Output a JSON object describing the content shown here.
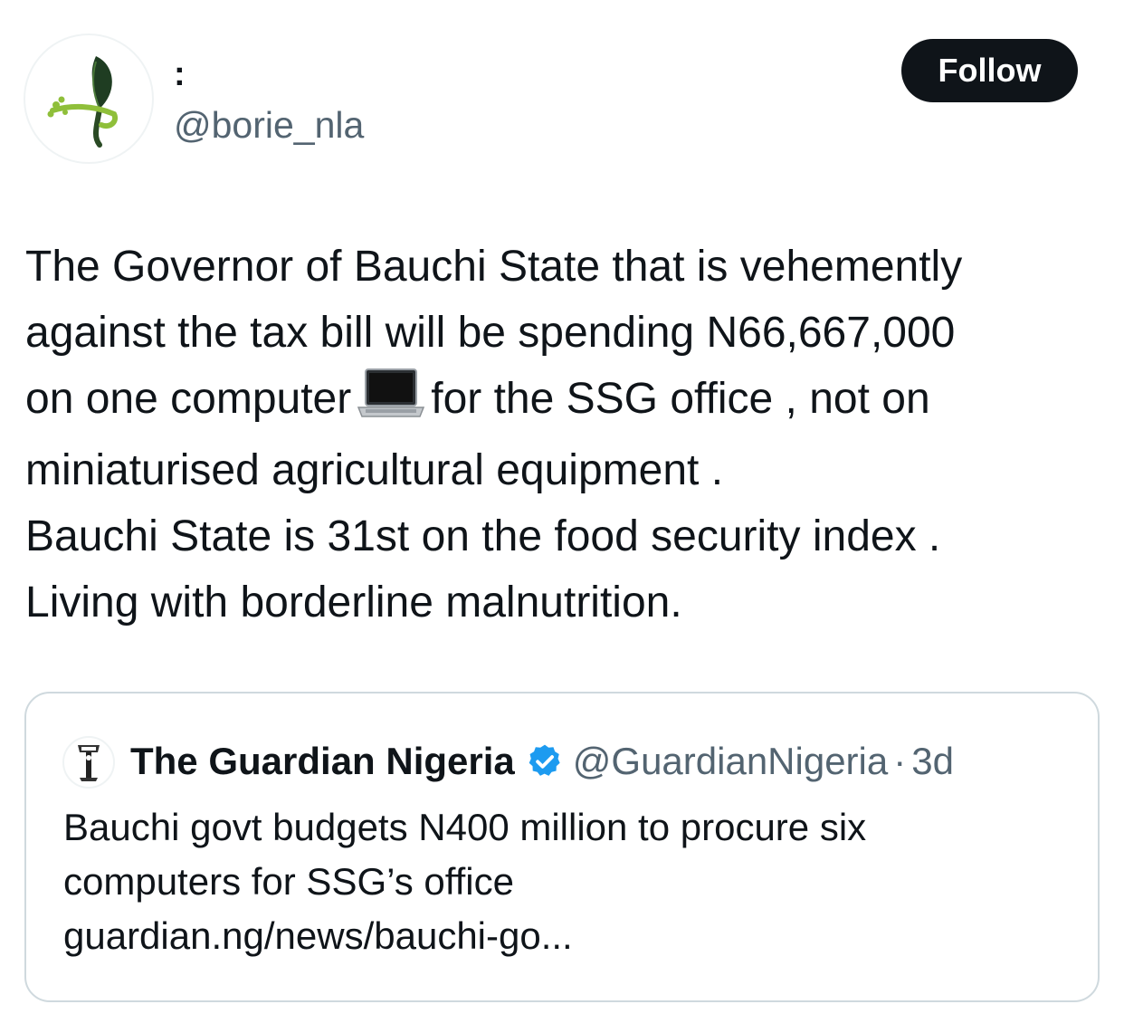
{
  "author": {
    "display_name": ":",
    "handle": "@borie_nla",
    "avatar_icon": "green-leaf-logo-icon"
  },
  "follow_label": "Follow",
  "tweet": {
    "line1": "The Governor of Bauchi State that is vehemently",
    "line2": "against the tax bill will be spending N66,667,000",
    "line3_before": "on one computer",
    "line3_emoji": "laptop-icon",
    "line3_after": "for the SSG office , not on",
    "line4": "miniaturised agricultural equipment .",
    "line5": "Bauchi State is 31st on the food security index .",
    "line6": "Living with borderline malnutrition."
  },
  "quote": {
    "avatar_icon": "guardian-crest-icon",
    "name": "The Guardian Nigeria",
    "verified_icon": "verified-badge-icon",
    "handle": "@GuardianNigeria",
    "separator": "·",
    "time": "3d",
    "line1": "Bauchi govt budgets N400 million to procure six",
    "line2": "computers for SSG’s office",
    "line3": "guardian.ng/news/bauchi-go..."
  },
  "colors": {
    "text": "#0f1419",
    "secondary": "#536471",
    "border": "#cfd9de",
    "verified": "#1d9bf0",
    "button": "#0f1419"
  }
}
